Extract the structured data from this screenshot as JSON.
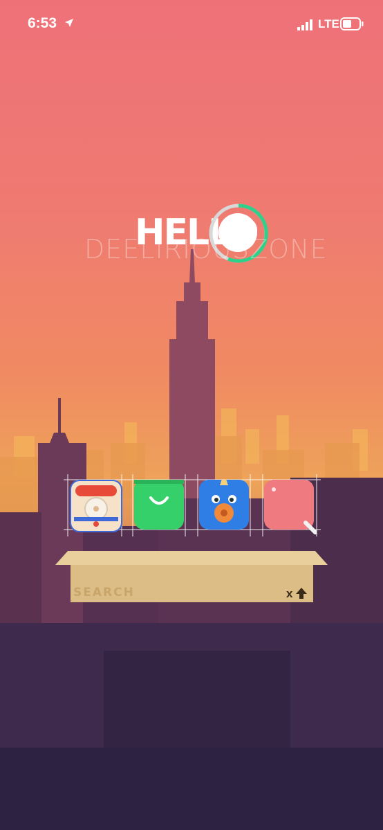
{
  "status_bar": {
    "time": "6:53",
    "network": "LTE"
  },
  "widget": {
    "hello": "HELLO",
    "subtitle": "DEELIRIOUSZONE"
  },
  "dock": {
    "icons": [
      "phone-toy-icon",
      "shopping-bag-icon",
      "unicorn-icon",
      "notes-icon"
    ]
  },
  "search": {
    "label": "SEARCH",
    "clear": "x"
  },
  "colors": {
    "ring": "#2fd08a",
    "box": "#dcbd86"
  }
}
